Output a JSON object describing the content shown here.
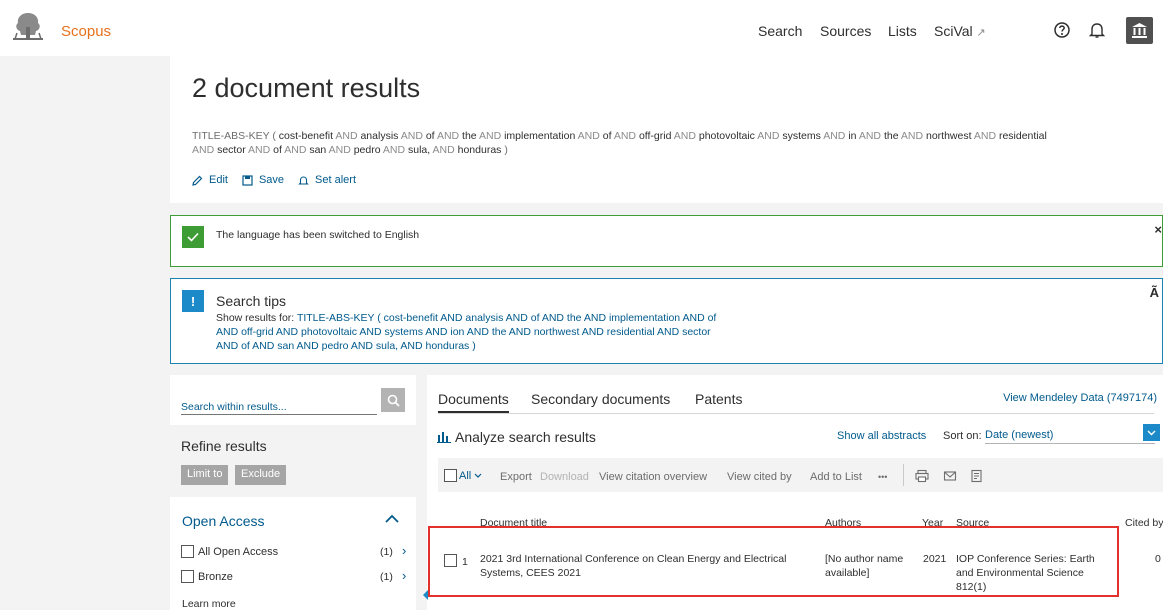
{
  "header": {
    "brand": "Scopus",
    "nav": [
      "Search",
      "Sources",
      "Lists",
      "SciVal"
    ],
    "scival_arrow": "↗",
    "icons": [
      "help-icon",
      "bell-icon",
      "institution-icon"
    ]
  },
  "query_panel": {
    "title": "2 document results",
    "query_line1": [
      [
        "f",
        "TITLE-ABS-KEY ( "
      ],
      [
        "t",
        "cost-benefit"
      ],
      [
        "o",
        " AND "
      ],
      [
        "t",
        "analysis"
      ],
      [
        "o",
        " AND "
      ],
      [
        "t",
        "of"
      ],
      [
        "o",
        " AND "
      ],
      [
        "t",
        "the"
      ],
      [
        "o",
        " AND "
      ],
      [
        "t",
        "implementation"
      ],
      [
        "o",
        " AND "
      ],
      [
        "t",
        "of"
      ],
      [
        "o",
        " AND "
      ],
      [
        "t",
        "off-grid"
      ],
      [
        "o",
        " AND "
      ],
      [
        "t",
        "photovoltaic"
      ],
      [
        "o",
        " AND "
      ],
      [
        "t",
        "systems"
      ],
      [
        "o",
        " AND "
      ],
      [
        "t",
        "in"
      ],
      [
        "o",
        " AND "
      ],
      [
        "t",
        "the"
      ],
      [
        "o",
        " AND "
      ],
      [
        "t",
        "northwest"
      ],
      [
        "o",
        " AND "
      ],
      [
        "t",
        "residential"
      ]
    ],
    "query_line2": [
      [
        "o",
        "AND "
      ],
      [
        "t",
        "sector"
      ],
      [
        "o",
        " AND "
      ],
      [
        "t",
        "of"
      ],
      [
        "o",
        " AND "
      ],
      [
        "t",
        "san"
      ],
      [
        "o",
        " AND "
      ],
      [
        "t",
        "pedro"
      ],
      [
        "o",
        " AND "
      ],
      [
        "t",
        "sula,"
      ],
      [
        "o",
        " AND "
      ],
      [
        "t",
        "honduras"
      ],
      [
        "f",
        " )"
      ]
    ],
    "actions": {
      "edit": "Edit",
      "save": "Save",
      "set_alert": "Set alert"
    }
  },
  "language_message": {
    "text": "The language has been switched to English",
    "close": "×"
  },
  "search_tips": {
    "title": "Search tips",
    "prefix": "Show results for:",
    "link_line1": "TITLE-ABS-KEY ( cost-benefit  AND analysis  AND of  AND the  AND implementation  AND of",
    "link_line2": "AND off-grid  AND photovoltaic  AND systems  AND ion  AND the  AND northwest  AND residential  AND sector",
    "link_line3": "AND of  AND san  AND pedro  AND sula,  AND honduras )",
    "corner": "Ã"
  },
  "refine": {
    "search_placeholder": "Search within results...",
    "title": "Refine results",
    "limit_to": "Limit to",
    "exclude": "Exclude",
    "open_access": {
      "title": "Open Access",
      "items": [
        {
          "label": "All Open Access",
          "count": "(1)"
        },
        {
          "label": "Bronze",
          "count": "(1)"
        }
      ],
      "learn_more": "Learn more"
    }
  },
  "results": {
    "tabs": [
      "Documents",
      "Secondary documents",
      "Patents"
    ],
    "mendeley": "View Mendeley Data (7497174)",
    "analyze": "Analyze search results",
    "show_abstracts": "Show all abstracts",
    "sort_label": "Sort on:",
    "sort_value": "Date (newest)",
    "toolbar": {
      "all": "All",
      "export": "Export",
      "download": "Download",
      "view_citation": "View citation overview",
      "view_cited": "View cited by",
      "add_to_list": "Add to List",
      "more": "•••"
    },
    "columns": {
      "title": "Document title",
      "authors": "Authors",
      "year": "Year",
      "source": "Source",
      "cited": "Cited by"
    },
    "rows": [
      {
        "num": "1",
        "title_l1": "2021 3rd International Conference on Clean Energy and Electrical",
        "title_l2": "Systems, CEES 2021",
        "authors_l1": "[No author name",
        "authors_l2": "available]",
        "year": "2021",
        "source_l1": "IOP Conference Series: Earth",
        "source_l2": "and Environmental Science",
        "source_l3": "812(1)",
        "cited": "0"
      }
    ]
  }
}
